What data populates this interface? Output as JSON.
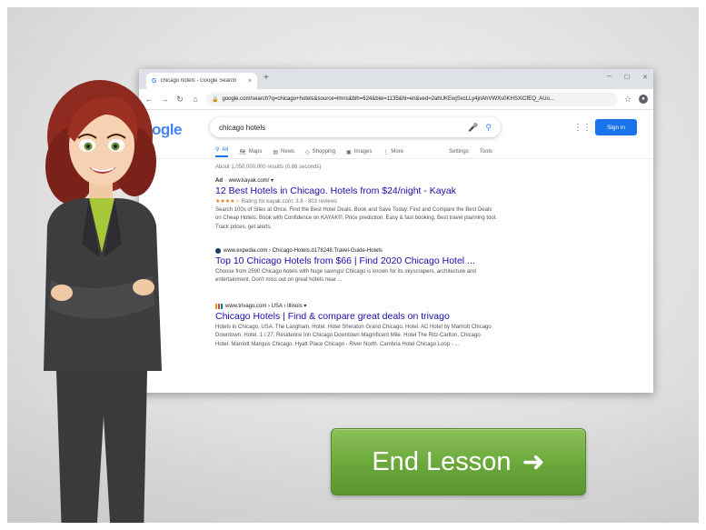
{
  "browser": {
    "tab_title": "chicago hotels - Google Search",
    "tab_favicon": "G",
    "tab_close": "×",
    "new_tab": "+",
    "url": "google.com/search?q=chicago+hotels&source=lmns&bih=624&biw=1135&hl=en&ved=2ahUKEwjSxcLLy4jnAhVWXs0KHSXiCfEQ_AUo..."
  },
  "google": {
    "logo": "ogle",
    "query": "chicago hotels",
    "signin_label": "Sign in",
    "tabs": [
      "All",
      "Maps",
      "News",
      "Shopping",
      "Images",
      "More"
    ],
    "tab_icons": [
      "search-icon",
      "map-icon",
      "news-icon",
      "tag-icon",
      "image-icon",
      "more-icon"
    ],
    "tools": [
      "Settings",
      "Tools"
    ],
    "stats": "About 1,050,000,000 results (0.88 seconds)",
    "results": [
      {
        "ad_label": "Ad",
        "url": "· www.kayak.com/ ▾",
        "title": "12 Best Hotels in Chicago. Hotels from $24/night - Kayak",
        "stars": "★★★★☆",
        "rating": "Rating for kayak.com: 3.8 - 803 reviews",
        "snippet": "Search 100s of Sites at Once. Find the Best Hotel Deals. Book and Save Today. Find and Compare the Best Deals on Cheap Hotels. Book with Confidence on KAYAK®. Price prediction. Easy & fast booking. Best travel planning tool. Track prices, get alerts."
      },
      {
        "url": "www.expedia.com › Chicago-Hotels.d178248.Travel-Guide-Hotels",
        "title": "Top 10 Chicago Hotels from $66 | Find 2020 Chicago Hotel ...",
        "snippet": "Choose from 2590 Chicago hotels with huge savings! Chicago is known for its skyscrapers, architecture and entertainment. Don't miss out on great hotels near ..."
      },
      {
        "url": "www.trivago.com › USA › Illinois ▾",
        "title": "Chicago Hotels | Find & compare great deals on trivago",
        "snippet": "Hotels in Chicago, USA. The Langham. Hotel. Hotel Sheraton Grand Chicago. Hotel. AC Hotel by Marriott Chicago Downtown. Hotel. 1 / 27. Residence Inn Chicago Downtown Magnificent Mile. Hotel The Ritz-Carlton, Chicago. Hotel. Marriott Marquis Chicago. Hyatt Place Chicago - River North. Cambria Hotel Chicago Loop - ..."
      }
    ]
  },
  "lesson": {
    "end_button_label": "End Lesson",
    "end_button_icon": "arrow-right-icon",
    "end_button_glyph": "➜"
  },
  "colors": {
    "button_green": "#6aa73a",
    "link_blue": "#1a0dab",
    "google_blue": "#1a73e8"
  }
}
